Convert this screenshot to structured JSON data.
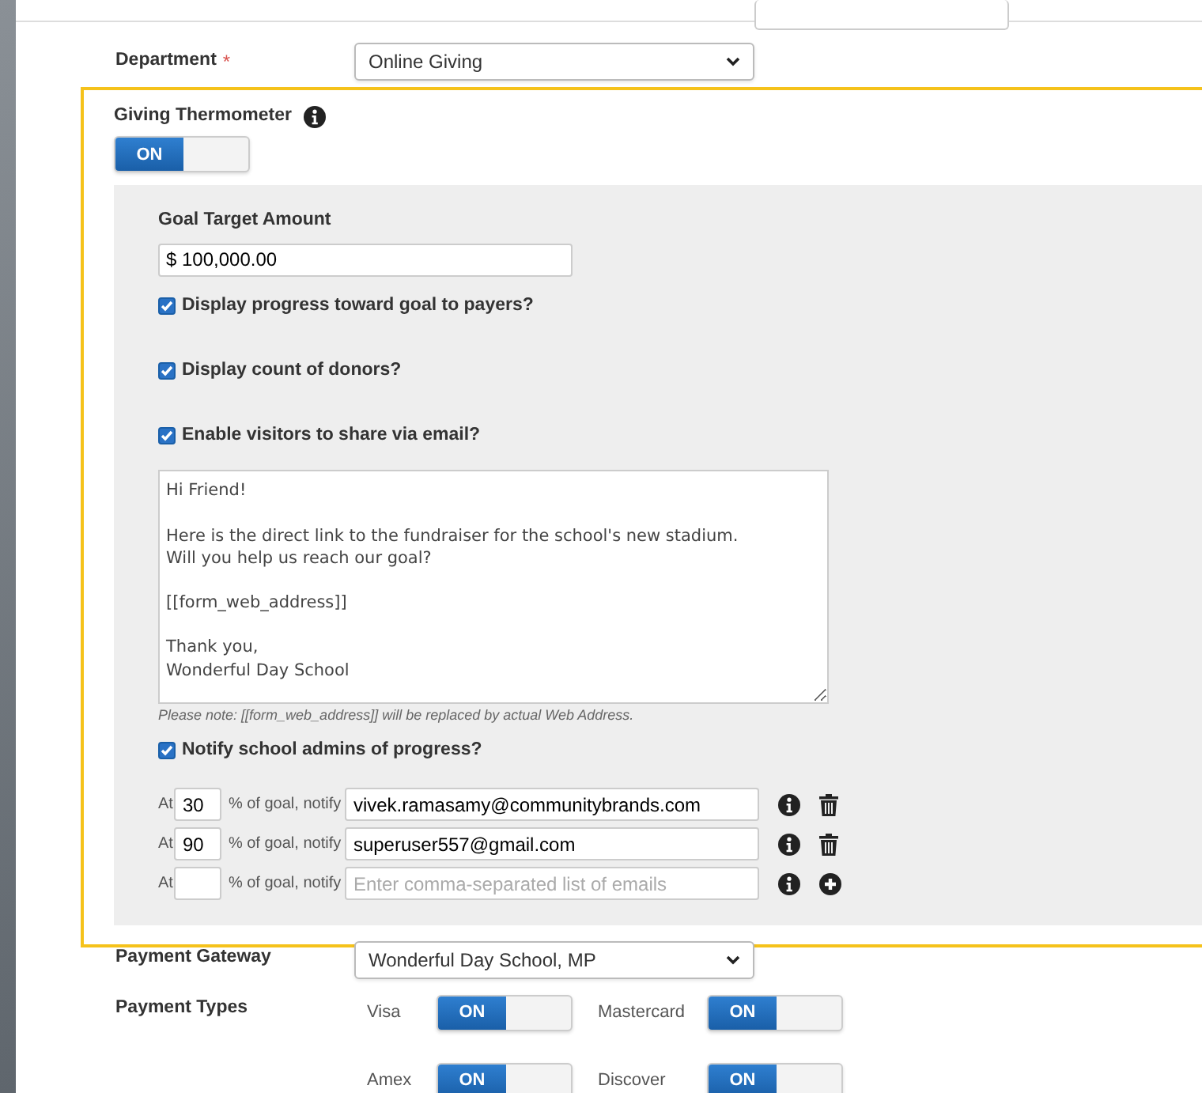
{
  "department": {
    "label": "Department",
    "required_mark": "*",
    "value": "Online Giving"
  },
  "thermometer": {
    "label": "Giving Thermometer",
    "toggle": {
      "label": "ON",
      "on": true
    },
    "goal": {
      "label": "Goal Target Amount",
      "value": "$ 100,000.00"
    },
    "options": [
      {
        "label": "Display progress toward goal to payers?",
        "checked": true
      },
      {
        "label": "Display count of donors?",
        "checked": true
      },
      {
        "label": "Enable visitors to share via email?",
        "checked": true
      }
    ],
    "message": "Hi Friend!\n\nHere is the direct link to the fundraiser for the school's new stadium.\nWill you help us reach our goal?\n\n[[form_web_address]]\n\nThank you,\nWonderful Day School",
    "note": "Please note: [[form_web_address]] will be replaced by actual Web Address.",
    "notify": {
      "label": "Notify school admins of progress?",
      "checked": true
    },
    "rules": [
      {
        "at": "At",
        "percent": "30",
        "of_goal": "% of goal, notify",
        "emails": "vivek.ramasamy@communitybrands.com",
        "kind": "delete"
      },
      {
        "at": "At",
        "percent": "90",
        "of_goal": "% of goal, notify",
        "emails": "superuser557@gmail.com",
        "kind": "delete"
      },
      {
        "at": "At",
        "of_goal": "% of goal, notify",
        "placeholder": "Enter comma-separated list of emails",
        "kind": "add"
      }
    ]
  },
  "gateway": {
    "label": "Payment Gateway",
    "value": "Wonderful Day School, MP"
  },
  "payment_types": {
    "label": "Payment Types",
    "items": [
      {
        "name": "Visa",
        "toggle": {
          "label": "ON",
          "on": true
        }
      },
      {
        "name": "Mastercard",
        "toggle": {
          "label": "ON",
          "on": true
        }
      },
      {
        "name": "Amex",
        "toggle": {
          "label": "ON",
          "on": true
        }
      },
      {
        "name": "Discover",
        "toggle": {
          "label": "ON",
          "on": true
        }
      }
    ]
  }
}
